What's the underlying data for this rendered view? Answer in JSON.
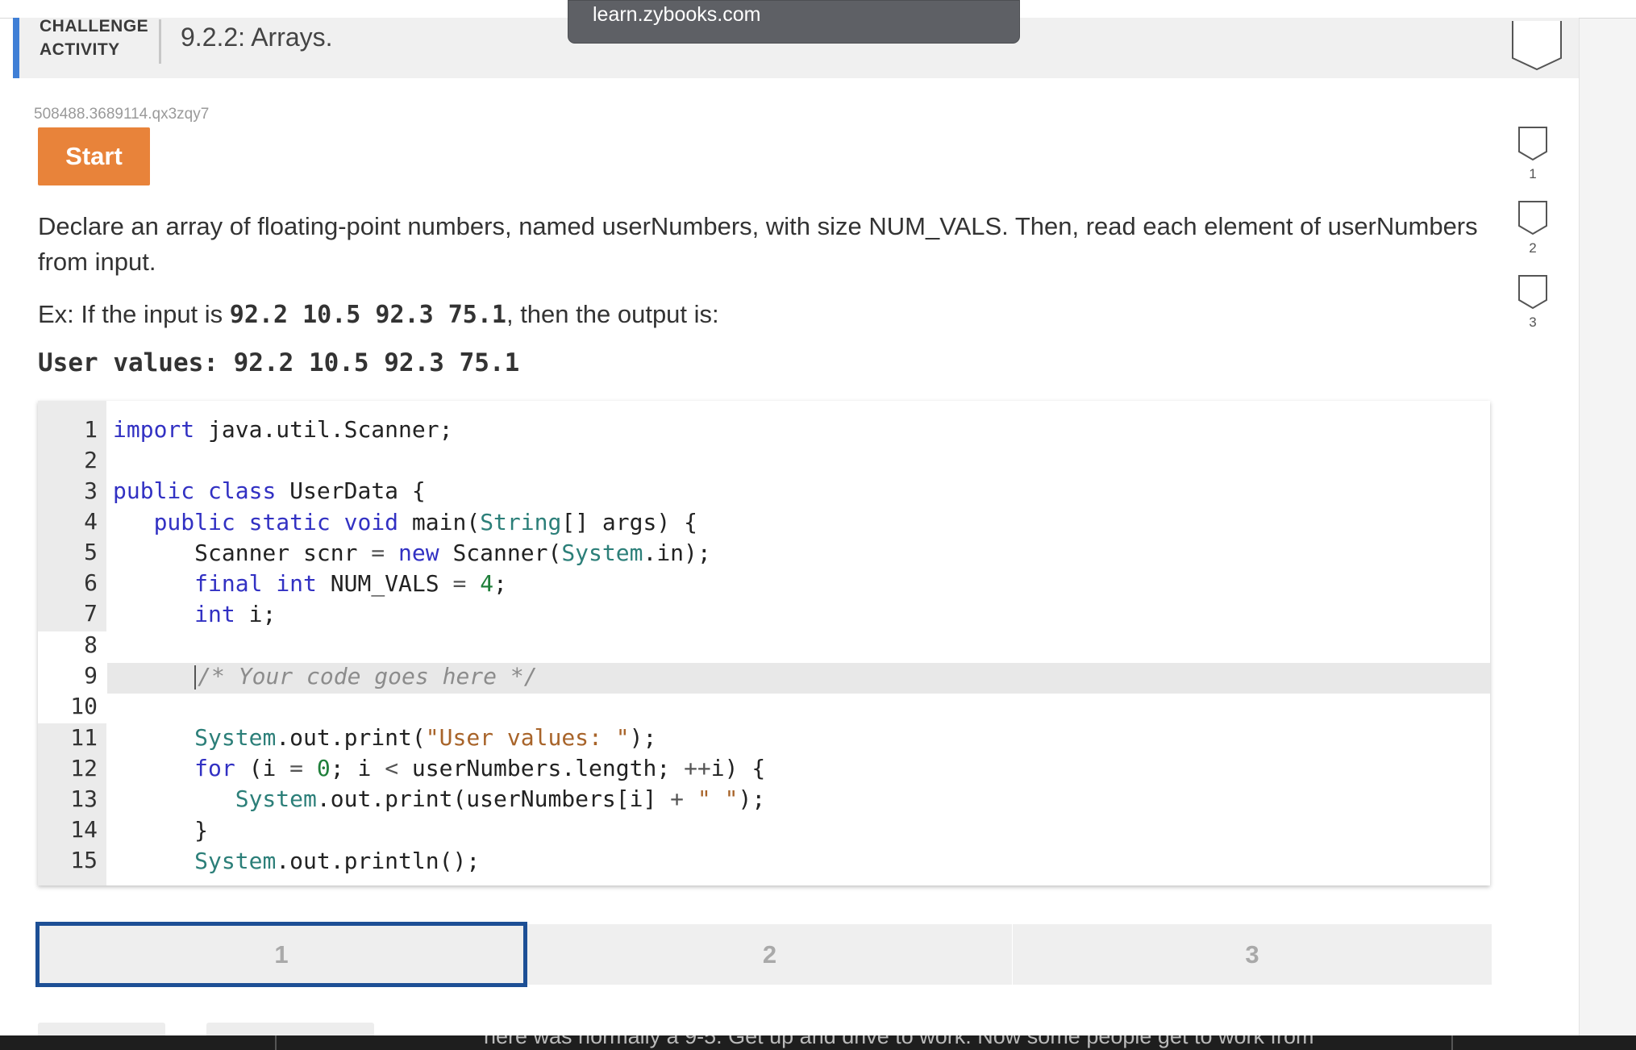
{
  "browser": {
    "url_tooltip": "learn.zybooks.com"
  },
  "header": {
    "type_line1": "CHALLENGE",
    "type_line2": "ACTIVITY",
    "title": "9.2.2: Arrays."
  },
  "activity": {
    "id": "508488.3689114.qx3zqy7",
    "start_label": "Start",
    "instructions": "Declare an array of floating-point numbers, named userNumbers, with size NUM_VALS. Then, read each element of userNumbers from input.",
    "example_prefix": "Ex: If the input is ",
    "example_input": "92.2 10.5 92.3 75.1",
    "example_suffix": ", then the output is:",
    "expected_output": "User values: 92.2 10.5 92.3 75.1"
  },
  "editor": {
    "line_numbers": [
      "1",
      "2",
      "3",
      "4",
      "5",
      "6",
      "7",
      "8",
      "9",
      "10",
      "11",
      "12",
      "13",
      "14",
      "15"
    ],
    "lines": [
      "import java.util.Scanner;",
      "",
      "public class UserData {",
      "   public static void main(String[] args) {",
      "      Scanner scnr = new Scanner(System.in);",
      "      final int NUM_VALS = 4;",
      "      int i;",
      "",
      "      /* Your code goes here */",
      "",
      "      System.out.print(\"User values: \");",
      "      for (i = 0; i < userNumbers.length; ++i) {",
      "         System.out.print(userNumbers[i] + \" \");",
      "      }",
      "      System.out.println();"
    ],
    "active_line": 9
  },
  "levels": {
    "tabs": [
      "1",
      "2",
      "3"
    ],
    "active": "1"
  },
  "progress": {
    "items": [
      "1",
      "2",
      "3"
    ]
  },
  "footer": {
    "partial_text": "here was normally a 9-5. Get up and drive to work. Now some people get to work from"
  },
  "colors": {
    "accent_blue": "#3f7fd6",
    "start_orange": "#e8833a",
    "active_level_border": "#1d4f95",
    "keyword": "#3231c3",
    "class_name": "#2c7f79",
    "string": "#a8642a",
    "number": "#1f7f3a",
    "comment": "#8c8c8c"
  }
}
